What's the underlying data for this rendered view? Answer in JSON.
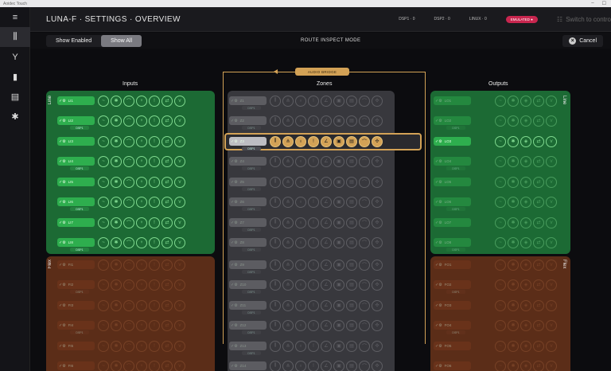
{
  "app": {
    "name": "Aoidec Touch",
    "title": "LUNA-F · SETTINGS · OVERVIEW"
  },
  "window_controls": [
    "–",
    "☐"
  ],
  "status": {
    "dsp1": "DSP1 · 0",
    "dsp2": "DSP2 · 0",
    "linux": "LINUX · 0",
    "emulated": "EMULATED ●",
    "switch": "Switch to contro"
  },
  "modebar": {
    "show_enabled": "Show Enabled",
    "show_all": "Show All",
    "mode": "ROUTE INSPECT MODE",
    "cancel": "Cancel"
  },
  "bridge_label": "AUDIO BRIDGE",
  "columns": {
    "inputs": "Inputs",
    "zones": "Zones",
    "outputs": "Outputs"
  },
  "groups": {
    "line": "Line",
    "flex": "Flex"
  },
  "sub_label": "DSP1",
  "inputs": [
    "LI1",
    "LI2",
    "LI3",
    "LI4",
    "LI5",
    "LI6",
    "LI7",
    "LI8",
    "FI1",
    "FI2",
    "FI3",
    "FI4",
    "FI5",
    "FI6"
  ],
  "zones": [
    "Z1",
    "Z2",
    "Z3",
    "Z4",
    "Z5",
    "Z6",
    "Z7",
    "Z8",
    "Z9",
    "Z10",
    "Z11",
    "Z12",
    "Z13",
    "Z14"
  ],
  "outputs": [
    "LO1",
    "LO2",
    "LO3",
    "LO4",
    "LO5",
    "LO6",
    "LO7",
    "LO8",
    "FO1",
    "FO2",
    "FO3",
    "FO4",
    "FO5",
    "FO6"
  ],
  "input_icons": [
    "~",
    "✱",
    "⌒",
    "♆",
    "!",
    "⇄",
    "⋎"
  ],
  "zone_icons": [
    "⫼",
    "⋔",
    "♁",
    "!",
    "∠",
    "▣",
    "▤",
    "⌒",
    "✣"
  ],
  "output_icons": [
    "~",
    "✱",
    "◈",
    "⇄",
    "⋎"
  ],
  "colors": {
    "line_bg": "#1c6a34",
    "line_pill": "#2eae4e",
    "flex_bg": "#5b2d18",
    "flex_pill": "#7a3a1d",
    "zone_bg": "#38383d",
    "zone_pill": "#88888e",
    "accent": "#d3a256"
  }
}
